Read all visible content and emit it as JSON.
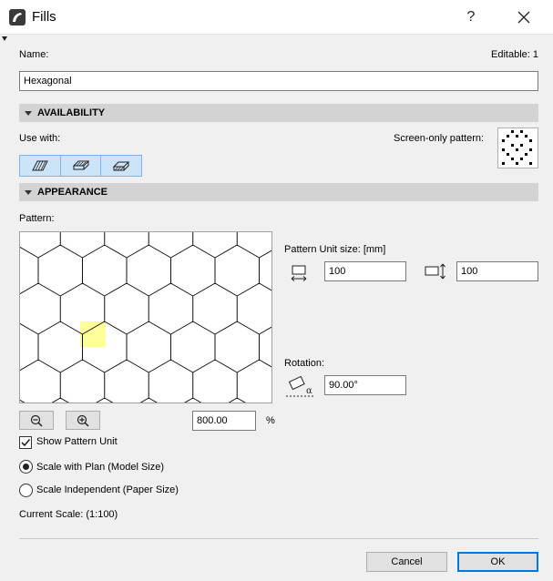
{
  "window": {
    "title": "Fills",
    "help_label": "?",
    "close_label": "✕"
  },
  "name": {
    "label": "Name:",
    "editable_label": "Editable: 1",
    "value": "Hexagonal"
  },
  "availability": {
    "header": "AVAILABILITY",
    "use_with_label": "Use with:",
    "screen_only_label": "Screen-only pattern:",
    "use_with_buttons": [
      "drafting-fills-icon",
      "cover-fills-icon",
      "cut-fills-icon"
    ]
  },
  "appearance": {
    "header": "APPEARANCE",
    "pattern_label": "Pattern:",
    "unit_size_label": "Pattern Unit size: [mm]",
    "unit_width": "100",
    "unit_height": "100",
    "rotation_label": "Rotation:",
    "rotation_value": "90.00°",
    "zoom_value": "800.00",
    "zoom_unit": "%",
    "show_pattern_unit_label": "Show Pattern Unit",
    "show_pattern_unit_checked": true,
    "scale_with_plan_label": "Scale with Plan (Model Size)",
    "scale_independent_label": "Scale Independent (Paper Size)",
    "scale_mode": "scale_with_plan",
    "current_scale_label": "Current Scale: (1:100)"
  },
  "footer": {
    "cancel_label": "Cancel",
    "ok_label": "OK"
  },
  "colors": {
    "accent": "#0078d7",
    "toggle_bg": "#cce4f7",
    "pattern_unit": "#ffff99",
    "section_bg": "#d3d3d3"
  }
}
